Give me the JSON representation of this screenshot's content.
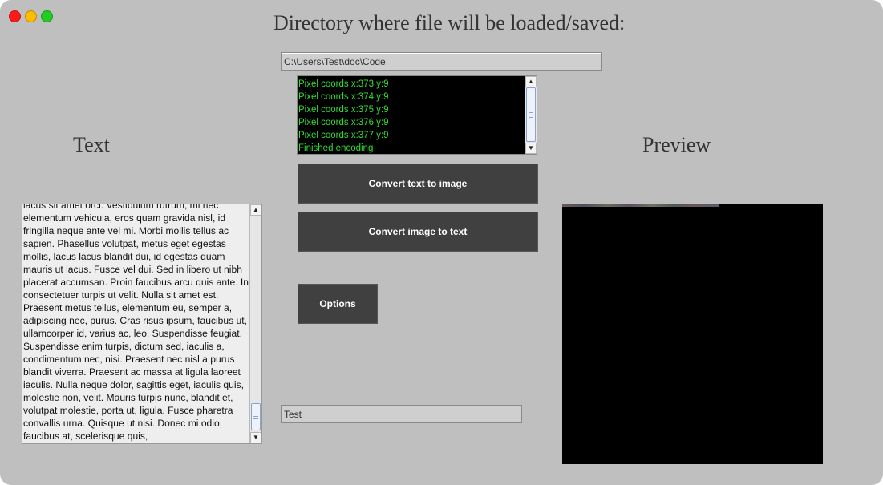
{
  "window": {
    "controls": {
      "close_color": "#ff1a1a",
      "minimize_color": "#ffbb00",
      "zoom_color": "#22cc22"
    }
  },
  "directory": {
    "label": "Directory where file will be loaded/saved:",
    "path": "C:\\Users\\Test\\doc\\Code"
  },
  "console": {
    "lines": [
      "Pixel coords x:373 y:9",
      "Pixel coords x:374 y:9",
      "Pixel coords x:375 y:9",
      "Pixel coords x:376 y:9",
      "Pixel coords x:377 y:9",
      "Finished encoding"
    ],
    "text_color": "#33dd33"
  },
  "buttons": {
    "text_to_image": "Convert text to image",
    "image_to_text": "Convert image to text",
    "options": "Options"
  },
  "text_panel": {
    "heading": "Text",
    "content": "lacus sit amet orci. Vestibulum rutrum, mi nec elementum vehicula, eros quam gravida nisl, id fringilla neque ante vel mi. Morbi mollis tellus ac sapien. Phasellus volutpat, metus eget egestas mollis, lacus lacus blandit dui, id egestas quam mauris ut lacus. Fusce vel dui. Sed in libero ut nibh placerat accumsan. Proin faucibus arcu quis ante. In consectetuer turpis ut velit. Nulla sit amet est. Praesent metus tellus, elementum eu, semper a, adipiscing nec, purus. Cras risus ipsum, faucibus ut, ullamcorper id, varius ac, leo. Suspendisse feugiat. Suspendisse enim turpis, dictum sed, iaculis a, condimentum nec, nisi. Praesent nec nisl a purus blandit viverra. Praesent ac massa at ligula laoreet iaculis. Nulla neque dolor, sagittis eget, iaculis quis, molestie non, velit. Mauris turpis nunc, blandit et, volutpat molestie, porta ut, ligula. Fusce pharetra convallis urna. Quisque ut nisi. Donec mi odio, faucibus at, scelerisque quis,"
  },
  "filename": {
    "value": "Test"
  },
  "preview": {
    "heading": "Preview"
  }
}
